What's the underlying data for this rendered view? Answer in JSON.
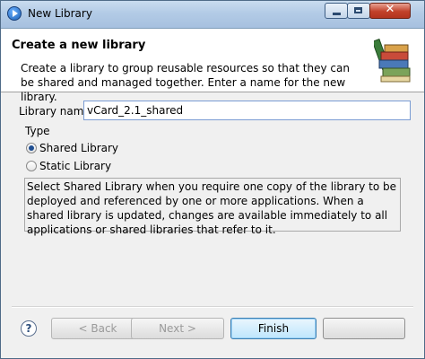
{
  "window": {
    "title": "New Library"
  },
  "header": {
    "title": "Create a new library",
    "description": "Create a library to group reusable resources so that they can be shared and managed together.  Enter a name for the new library."
  },
  "form": {
    "library_name_label": "Library name",
    "library_name_value": "vCard_2.1_shared",
    "type_label": "Type",
    "options": [
      {
        "label": "Shared Library",
        "selected": true
      },
      {
        "label": "Static Library",
        "selected": false
      }
    ],
    "type_description": "Select Shared Library when you require one copy of the library to be deployed and referenced by one or more applications.  When a shared library is updated, changes are available immediately to all applications or shared libraries that refer to it."
  },
  "footer": {
    "help_icon": "?",
    "back_label": "< Back",
    "next_label": "Next >",
    "finish_label": "Finish",
    "cancel_label": ""
  },
  "icons": [
    "app-icon",
    "minimize-icon",
    "maximize-icon",
    "close-icon",
    "library-books-icon",
    "help-icon"
  ]
}
